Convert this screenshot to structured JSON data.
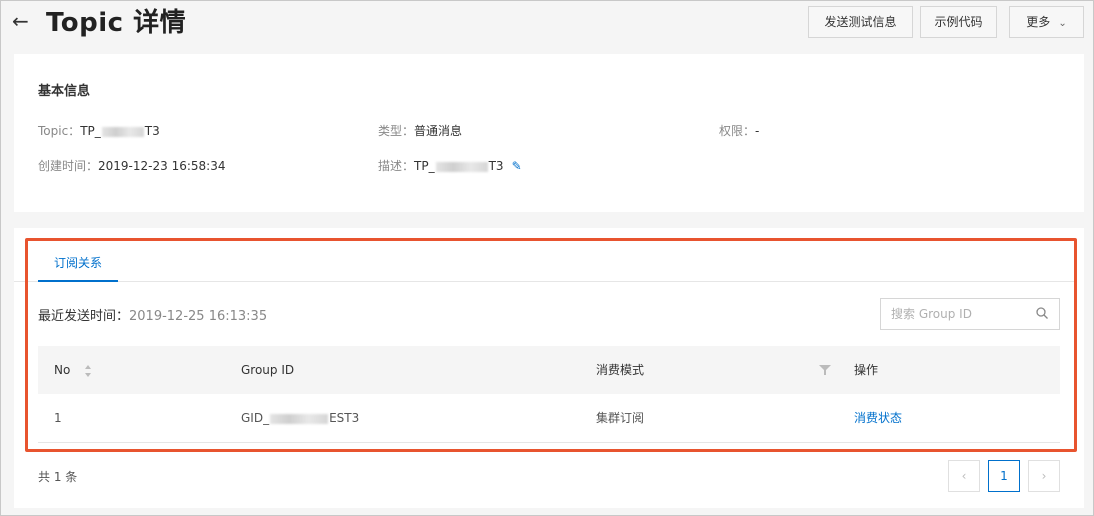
{
  "header": {
    "title": "Topic 详情",
    "buttons": {
      "send_test": "发送测试信息",
      "sample_code": "示例代码",
      "more": "更多"
    }
  },
  "basic_info": {
    "title": "基本信息",
    "topic_label": "Topic：",
    "topic_prefix": "TP_",
    "topic_suffix": "T3",
    "type_label": "类型：",
    "type_value": "普通消息",
    "permission_label": "权限：",
    "permission_value": "-",
    "created_label": "创建时间：",
    "created_value": "2019-12-23 16:58:34",
    "desc_label": "描述：",
    "desc_prefix": "TP_",
    "desc_suffix": "T3"
  },
  "subscription": {
    "tab_label": "订阅关系",
    "last_send_label": "最近发送时间：",
    "last_send_value": "2019-12-25 16:13:35",
    "search_placeholder": "搜索 Group ID",
    "columns": {
      "no": "No",
      "group_id": "Group ID",
      "mode": "消费模式",
      "action": "操作"
    },
    "rows": [
      {
        "no": "1",
        "group_prefix": "GID_",
        "group_suffix": "EST3",
        "mode": "集群订阅",
        "action": "消费状态"
      }
    ],
    "total": "共 1 条",
    "current_page": "1"
  },
  "colors": {
    "accent": "#0070cc",
    "highlight": "#e8542f"
  }
}
